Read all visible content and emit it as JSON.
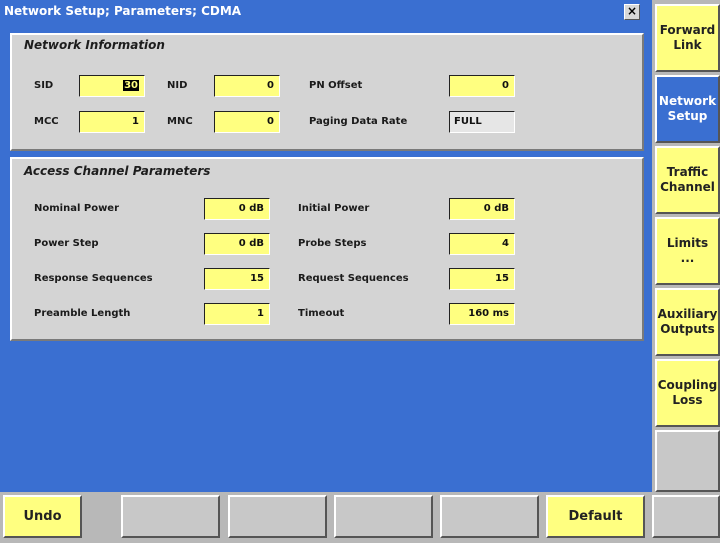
{
  "window": {
    "title": "Network Setup; Parameters; CDMA",
    "close_glyph": "×"
  },
  "network_info": {
    "title": "Network Information",
    "sid": {
      "label": "SID",
      "value": "30"
    },
    "nid": {
      "label": "NID",
      "value": "0"
    },
    "pn_offset": {
      "label": "PN Offset",
      "value": "0"
    },
    "mcc": {
      "label": "MCC",
      "value": "1"
    },
    "mnc": {
      "label": "MNC",
      "value": "0"
    },
    "paging_data_rate": {
      "label": "Paging Data Rate",
      "value": "FULL"
    }
  },
  "access_channel": {
    "title": "Access Channel Parameters",
    "nominal_power": {
      "label": "Nominal Power",
      "value": "0 dB"
    },
    "initial_power": {
      "label": "Initial Power",
      "value": "0 dB"
    },
    "power_step": {
      "label": "Power Step",
      "value": "0 dB"
    },
    "probe_steps": {
      "label": "Probe Steps",
      "value": "4"
    },
    "response_sequences": {
      "label": "Response Sequences",
      "value": "15"
    },
    "request_sequences": {
      "label": "Request Sequences",
      "value": "15"
    },
    "preamble_length": {
      "label": "Preamble Length",
      "value": "1"
    },
    "timeout": {
      "label": "Timeout",
      "value": "160 ms"
    }
  },
  "softkeys_right": {
    "forward_link": {
      "line1": "Forward",
      "line2": "Link"
    },
    "network_setup": {
      "line1": "Network",
      "line2": "Setup"
    },
    "traffic_channel": {
      "line1": "Traffic",
      "line2": "Channel"
    },
    "limits": {
      "line1": "Limits",
      "line2": "..."
    },
    "auxiliary_outputs": {
      "line1": "Auxiliary",
      "line2": "Outputs"
    },
    "coupling_loss": {
      "line1": "Coupling",
      "line2": "Loss"
    }
  },
  "softkeys_bottom": {
    "undo": "Undo",
    "default": "Default"
  },
  "colors": {
    "accent_blue": "#3a6fd1",
    "field_yellow": "#ffff80",
    "panel_gray": "#d4d4d4",
    "softkey_gray": "#c8c8c8"
  }
}
